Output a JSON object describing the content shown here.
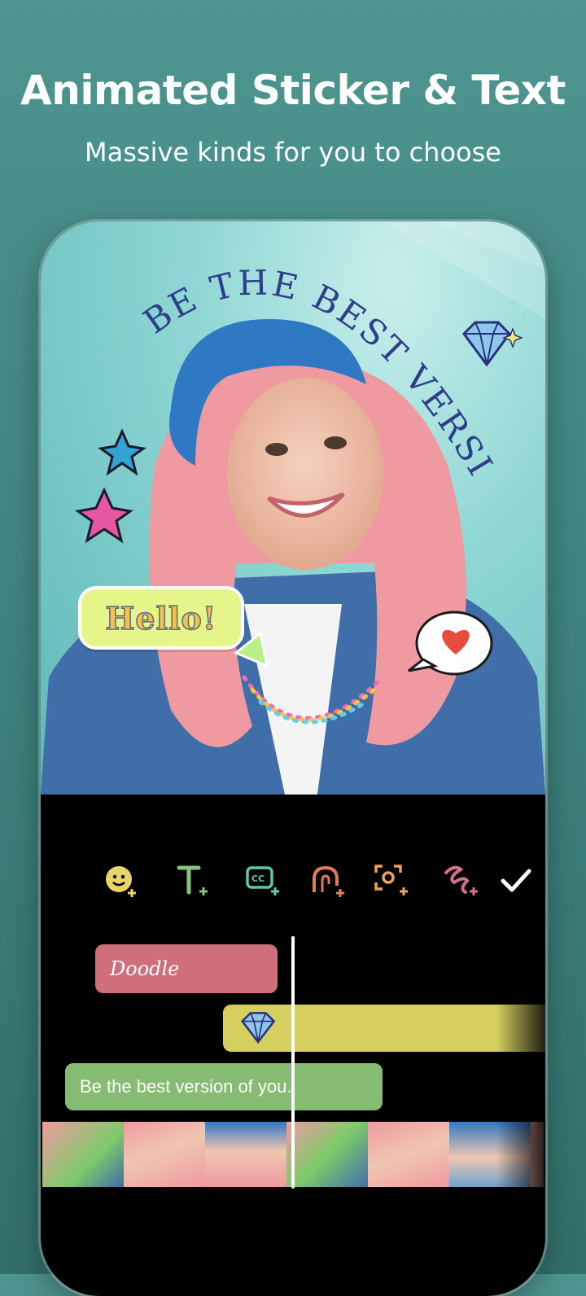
{
  "hero": {
    "title": "Animated Sticker & Text",
    "subtitle": "Massive kinds for you to choose"
  },
  "preview": {
    "arc_text": "BE THE BEST VERSION OF YOU.",
    "hello_sticker": "Hello!",
    "stickers": [
      "star-icon",
      "diamond-icon",
      "heart-speech-bubble-icon",
      "sparkle-icon"
    ]
  },
  "toolbar": {
    "tools": [
      {
        "name": "add-sticker",
        "icon": "smiley-plus-icon",
        "color": "#e7d56a"
      },
      {
        "name": "add-text",
        "icon": "text-plus-icon",
        "color": "#86c57c"
      },
      {
        "name": "add-caption",
        "icon": "caption-plus-icon",
        "color": "#5fc6a9"
      },
      {
        "name": "add-effect",
        "icon": "magnet-plus-icon",
        "color": "#e07a5f"
      },
      {
        "name": "add-focus",
        "icon": "focus-plus-icon",
        "color": "#f0a05a"
      },
      {
        "name": "add-doodle",
        "icon": "squiggle-plus-icon",
        "color": "#d27386"
      },
      {
        "name": "confirm",
        "icon": "checkmark-icon",
        "color": "#ffffff"
      }
    ]
  },
  "timeline": {
    "doodle_clip": "Doodle",
    "sticker_clip_icon": "diamond-icon",
    "text_clip": "Be the best version of you."
  },
  "colors": {
    "background": "#3f8580",
    "doodle_track": "#cf6f7c",
    "sticker_track": "#d4cf5f",
    "text_track": "#86bb74"
  }
}
